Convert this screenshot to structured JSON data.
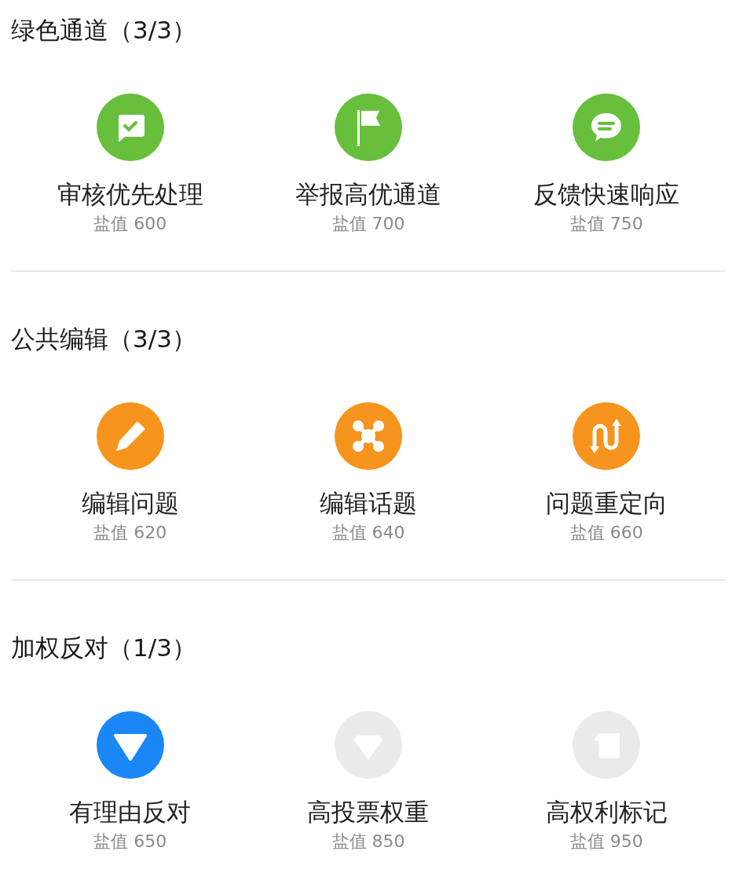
{
  "sections": [
    {
      "title": "绿色通道（3/3）",
      "color": "#67bf3c",
      "items": [
        {
          "kind": "chat-check",
          "label": "审核优先处理",
          "cost": "盐值 600",
          "unlocked": true
        },
        {
          "kind": "flag",
          "label": "举报高优通道",
          "cost": "盐值 700",
          "unlocked": true
        },
        {
          "kind": "chat-lines",
          "label": "反馈快速响应",
          "cost": "盐值 750",
          "unlocked": true
        }
      ]
    },
    {
      "title": "公共编辑（3/3）",
      "color": "#f7941d",
      "items": [
        {
          "kind": "pencil",
          "label": "编辑问题",
          "cost": "盐值 620",
          "unlocked": true
        },
        {
          "kind": "nodes",
          "label": "编辑话题",
          "cost": "盐值 640",
          "unlocked": true
        },
        {
          "kind": "redirect",
          "label": "问题重定向",
          "cost": "盐值 660",
          "unlocked": true
        }
      ]
    },
    {
      "title": "加权反对（1/3）",
      "color": "#1a87f7",
      "items": [
        {
          "kind": "triangle",
          "label": "有理由反对",
          "cost": "盐值 650",
          "unlocked": true
        },
        {
          "kind": "gem",
          "label": "高投票权重",
          "cost": "盐值 850",
          "unlocked": false
        },
        {
          "kind": "tag",
          "label": "高权利标记",
          "cost": "盐值 950",
          "unlocked": false
        }
      ]
    }
  ]
}
